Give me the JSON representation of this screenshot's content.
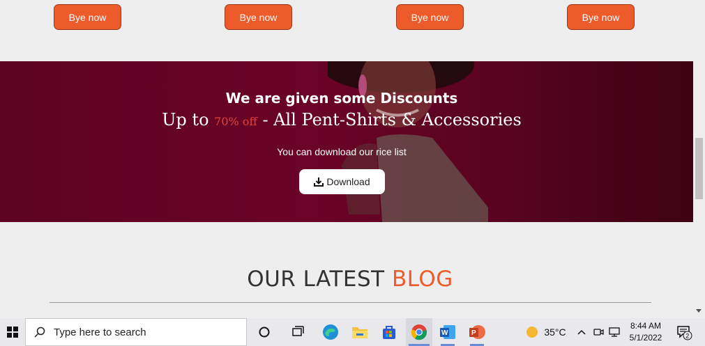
{
  "products": {
    "buy_buttons": [
      "Bye now",
      "Bye now",
      "Bye now",
      "Bye now"
    ]
  },
  "banner": {
    "title": "We are given some Discounts",
    "sub_prefix": "Up to ",
    "sub_percent": "70% off",
    "sub_suffix": " - All Pent-Shirts & Accessories",
    "note": "You can download our rice list",
    "download_label": "Download",
    "bg_color": "#6a0327",
    "percent_color": "#e8413a"
  },
  "blog": {
    "title_part1": "OUR LATEST",
    "title_part2": "BLOG",
    "accent_color": "#ee5b2a"
  },
  "taskbar": {
    "search_placeholder": "Type here to search",
    "apps": [
      "task-view",
      "edge",
      "file-explorer",
      "microsoft-store",
      "chrome",
      "word",
      "powerpoint"
    ],
    "weather_temp": "35°C",
    "time": "8:44 AM",
    "date": "5/1/2022",
    "notification_count": "2"
  }
}
